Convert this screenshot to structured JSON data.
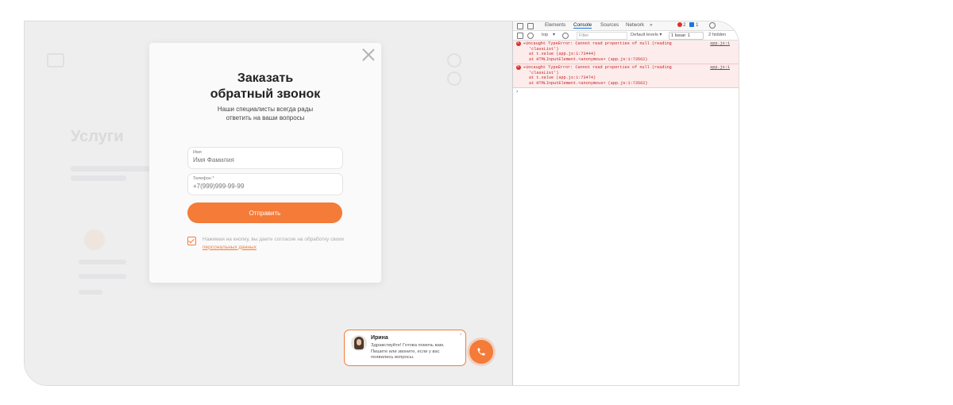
{
  "modal": {
    "title_line1": "Заказать",
    "title_line2": "обратный звонок",
    "subtitle_line1": "Наши специалисты всегда рады",
    "subtitle_line2": "ответить на ваши вопросы",
    "name_label": "Имя",
    "name_placeholder": "Имя Фамилия",
    "phone_label": "Телефон *",
    "phone_placeholder": "+7(999)999-99-99",
    "submit_label": "Отправить",
    "consent_text": "Нажимая на кнопку, вы даете согласие на обработку своих",
    "consent_link": "персональных данных",
    "consent_checked": true
  },
  "background": {
    "section_title": "Услуги"
  },
  "chat": {
    "name": "Ирина",
    "message": "Здравствуйте! Готова помочь вам. Пишите или звоните, если у вас появились вопросы.",
    "close": "×"
  },
  "devtools": {
    "tabs": [
      "Elements",
      "Console",
      "Sources",
      "Network",
      "»"
    ],
    "active_tab": "Console",
    "error_count": "2",
    "info_count": "1",
    "context": "top",
    "filter_placeholder": "Filter",
    "levels": "Default levels ▾",
    "issues_label": "1 Issue:",
    "issues_count": "1",
    "hidden": "2 hidden",
    "errors": [
      {
        "line1": "▸Uncaught TypeError: Cannot read properties of null (reading",
        "line2": "'classList')",
        "line3": "at t.value (app.js:1:73444)",
        "line4": "at HTMLInputElement.<anonymous> (app.js:1:73562)",
        "source": "app.js:1"
      },
      {
        "line1": "▸Uncaught TypeError: Cannot read properties of null (reading",
        "line2": "'classList')",
        "line3": "at t.value (app.js:1:73474)",
        "line4": "at HTMLInputElement.<anonymous> (app.js:1:73562)",
        "source": "app.js:1"
      }
    ],
    "prompt": "›"
  },
  "colors": {
    "accent": "#f47b38",
    "error_bg": "#fdecec",
    "error_text": "#c5221f"
  }
}
